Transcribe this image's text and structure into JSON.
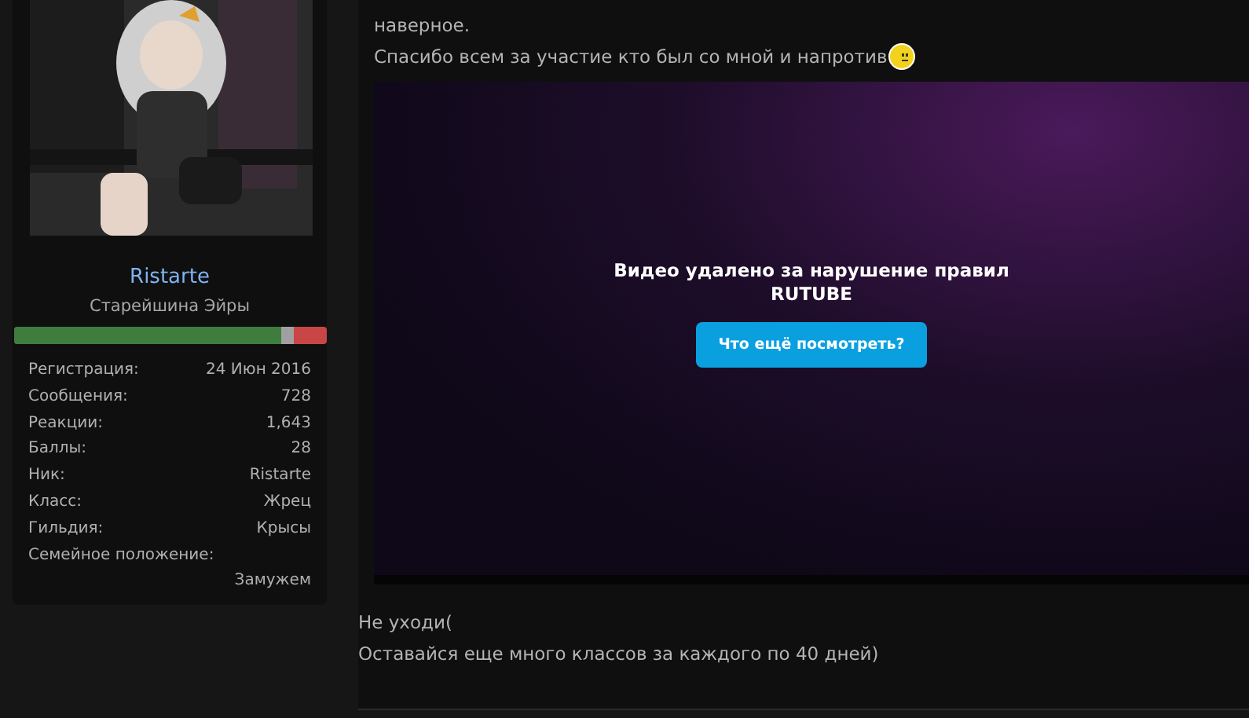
{
  "author": {
    "name": "Ristarte",
    "title": "Старейшина Эйры",
    "reputation": {
      "level": 0.855
    },
    "stats": [
      {
        "label": "Регистрация:",
        "value": "24 Июн 2016"
      },
      {
        "label": "Сообщения:",
        "value": "728"
      },
      {
        "label": "Реакции:",
        "value": "1,643"
      },
      {
        "label": "Баллы:",
        "value": "28"
      },
      {
        "label": "Ник:",
        "value": "Ristarte"
      },
      {
        "label": "Класс:",
        "value": "Жрец"
      },
      {
        "label": "Гильдия:",
        "value": "Крысы"
      },
      {
        "label": "Семейное положение:",
        "value": "Замужем"
      }
    ]
  },
  "post": {
    "lines": [
      "наверное.",
      "Спасибо всем за участие кто был со мной и напротив"
    ],
    "video": {
      "message": "Видео удалено за нарушение правил RUTUBE",
      "button": "Что ещё посмотреть?"
    },
    "after": [
      "Не уходи(",
      "Оставайся еще много классов за каждого по 40 дней)"
    ]
  }
}
